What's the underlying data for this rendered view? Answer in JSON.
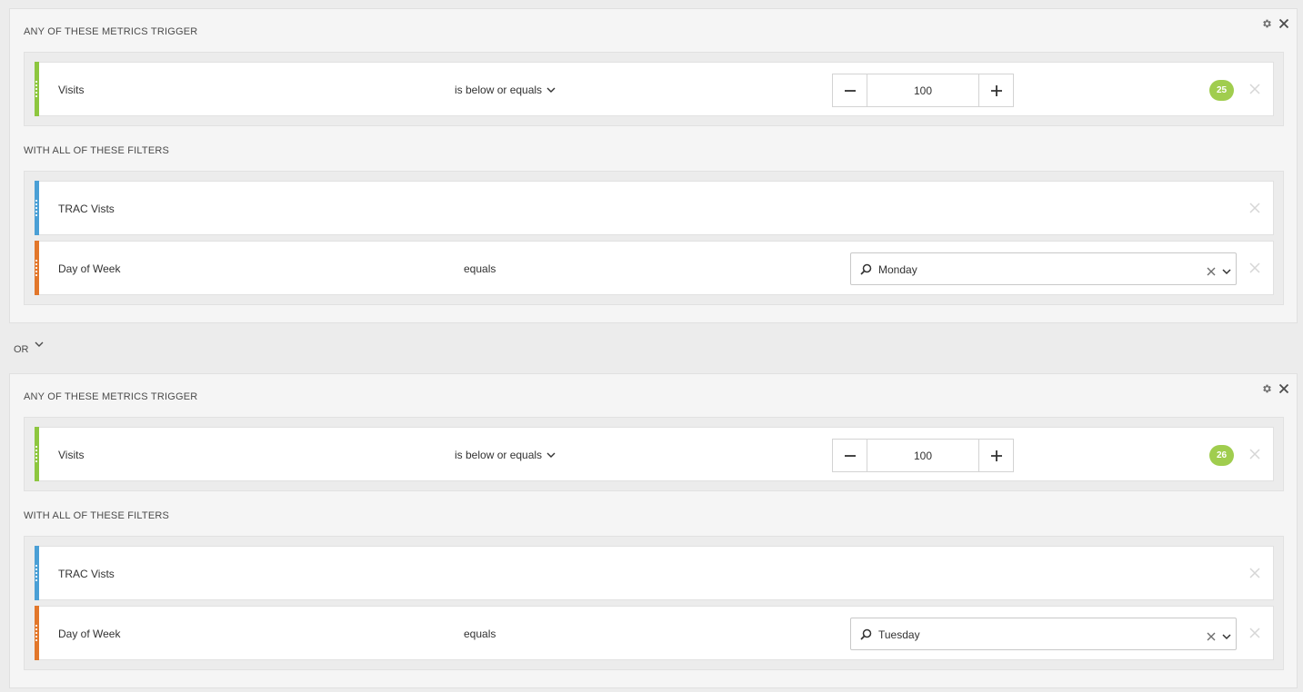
{
  "colors": {
    "metric_bar": "#8dc63f",
    "filter_bar_segment": "#4a9fd5",
    "filter_bar_dimension": "#e2772b",
    "badge": "#a0cd4e"
  },
  "icons": {
    "settings": "gear-icon",
    "close": "close-icon",
    "minus": "minus-icon",
    "plus": "plus-icon",
    "search": "search-icon",
    "clear": "clear-icon",
    "chevron": "chevron-down-icon"
  },
  "connector": {
    "label": "OR"
  },
  "blocks": [
    {
      "metrics_title": "ANY OF THESE METRICS TRIGGER",
      "filters_title": "WITH ALL OF THESE FILTERS",
      "metric": {
        "name": "Visits",
        "operator": "is below or equals",
        "value": "100",
        "badge": "25"
      },
      "filters": [
        {
          "name": "TRAC Vists"
        },
        {
          "name": "Day of Week",
          "operator": "equals",
          "value": "Monday"
        }
      ]
    },
    {
      "metrics_title": "ANY OF THESE METRICS TRIGGER",
      "filters_title": "WITH ALL OF THESE FILTERS",
      "metric": {
        "name": "Visits",
        "operator": "is below or equals",
        "value": "100",
        "badge": "26"
      },
      "filters": [
        {
          "name": "TRAC Vists"
        },
        {
          "name": "Day of Week",
          "operator": "equals",
          "value": "Tuesday"
        }
      ]
    }
  ]
}
